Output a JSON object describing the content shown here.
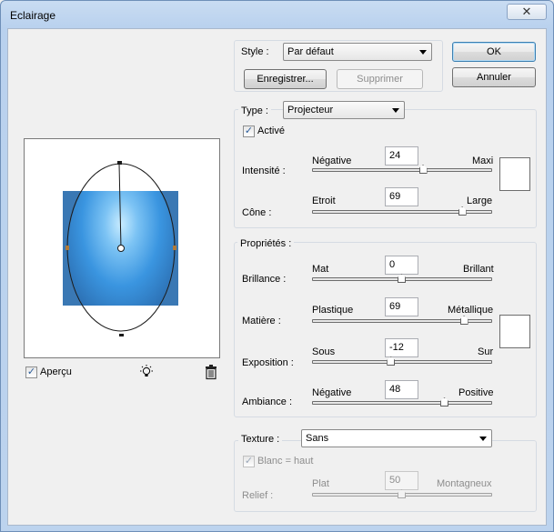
{
  "window": {
    "title": "Eclairage",
    "close_glyph": "✕"
  },
  "style_group": {
    "label": "Style :",
    "value": "Par défaut",
    "save_label": "Enregistrer...",
    "delete_label": "Supprimer"
  },
  "dialog_buttons": {
    "ok": "OK",
    "cancel": "Annuler"
  },
  "type_group": {
    "label": "Type :",
    "value": "Projecteur",
    "active_label": "Activé",
    "active_checked": true,
    "intensity": {
      "label": "Intensité :",
      "min_label": "Négative",
      "max_label": "Maxi",
      "value": "24",
      "fraction": 0.62
    },
    "cone": {
      "label": "Cône :",
      "min_label": "Etroit",
      "max_label": "Large",
      "value": "69",
      "fraction": 0.84
    }
  },
  "properties_group": {
    "title": "Propriétés :",
    "gloss": {
      "label": "Brillance :",
      "min_label": "Mat",
      "max_label": "Brillant",
      "value": "0",
      "fraction": 0.5
    },
    "material": {
      "label": "Matière :",
      "min_label": "Plastique",
      "max_label": "Métallique",
      "value": "69",
      "fraction": 0.85
    },
    "exposure": {
      "label": "Exposition :",
      "min_label": "Sous",
      "max_label": "Sur",
      "value": "-12",
      "fraction": 0.44
    },
    "ambience": {
      "label": "Ambiance :",
      "min_label": "Négative",
      "max_label": "Positive",
      "value": "48",
      "fraction": 0.74
    }
  },
  "texture_group": {
    "label": "Texture :",
    "value": "Sans",
    "white_high_label": "Blanc = haut",
    "white_high_checked": true,
    "relief": {
      "label": "Relief :",
      "min_label": "Plat",
      "max_label": "Montagneux",
      "value": "50",
      "fraction": 0.5
    }
  },
  "preview": {
    "label": "Aperçu",
    "checked": true,
    "light_icon": "lightbulb-icon",
    "trash_icon": "trash-icon"
  },
  "colors": {
    "light_blue": "#3e97e0",
    "swatch": "#ffffff"
  }
}
